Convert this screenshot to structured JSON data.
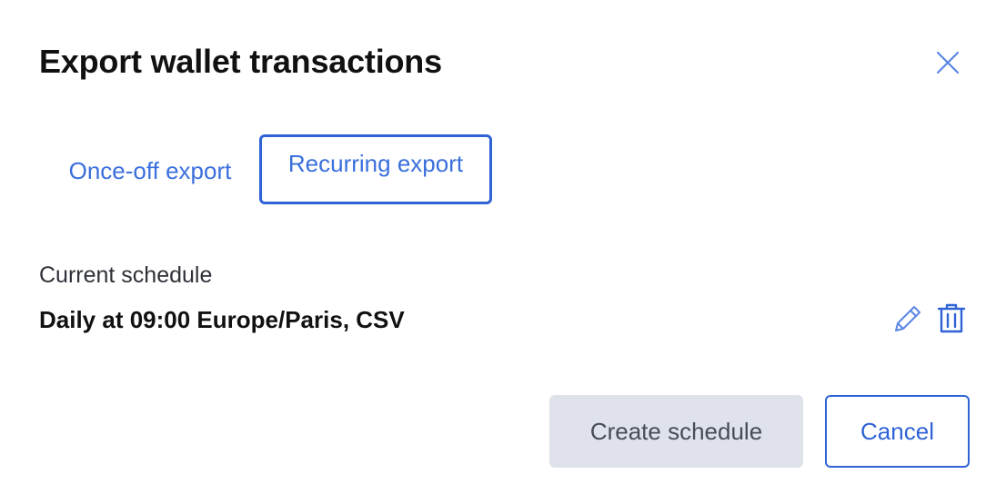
{
  "dialog": {
    "title": "Export wallet transactions",
    "close_icon": "close-icon"
  },
  "tabs": [
    {
      "label": "Once-off export",
      "selected": false
    },
    {
      "label": "Recurring export",
      "selected": true
    }
  ],
  "schedule": {
    "label": "Current schedule",
    "value": "Daily at 09:00 Europe/Paris, CSV",
    "edit_icon": "pencil-icon",
    "delete_icon": "trash-icon"
  },
  "actions": {
    "create_label": "Create schedule",
    "cancel_label": "Cancel"
  },
  "colors": {
    "accent": "#2f63d6",
    "link": "#3a6fdc",
    "disabled_bg": "#dfe2ea"
  }
}
